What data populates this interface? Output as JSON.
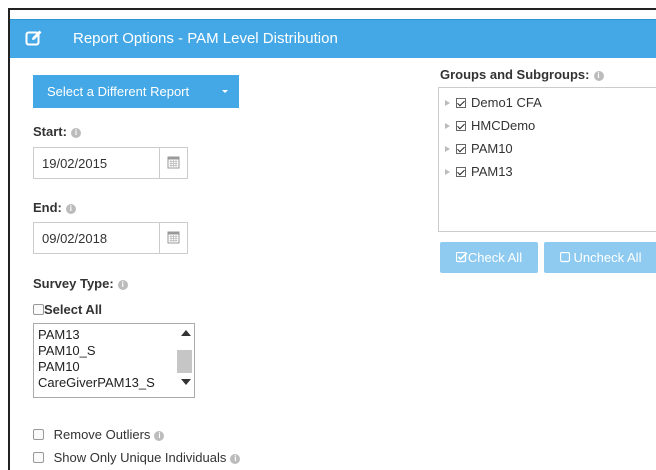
{
  "header": {
    "title": "Report Options - PAM Level Distribution",
    "icon": "edit-icon"
  },
  "select_report_button": {
    "label": "Select a Different Report",
    "icon": "caret-down-icon"
  },
  "start": {
    "label": "Start:",
    "value": "19/02/2015"
  },
  "end": {
    "label": "End:",
    "value": "09/02/2018"
  },
  "survey_type": {
    "label": "Survey Type:",
    "select_all_label": "Select All",
    "options": [
      "PAM13",
      "PAM10_S",
      "PAM10",
      "CareGiverPAM13_S"
    ]
  },
  "groups": {
    "label": "Groups and Subgroups:",
    "items": [
      {
        "label": "Demo1 CFA",
        "checked": true
      },
      {
        "label": "HMCDemo",
        "checked": true
      },
      {
        "label": "PAM10",
        "checked": true
      },
      {
        "label": "PAM13",
        "checked": true
      }
    ],
    "check_all_label": "Check All",
    "uncheck_all_label": "Uncheck All"
  },
  "options": {
    "remove_outliers_label": "Remove Outliers",
    "unique_individuals_label": "Show Only Unique Individuals"
  },
  "colors": {
    "accent": "#45a8e6",
    "accent_light": "#8fcbf0"
  }
}
